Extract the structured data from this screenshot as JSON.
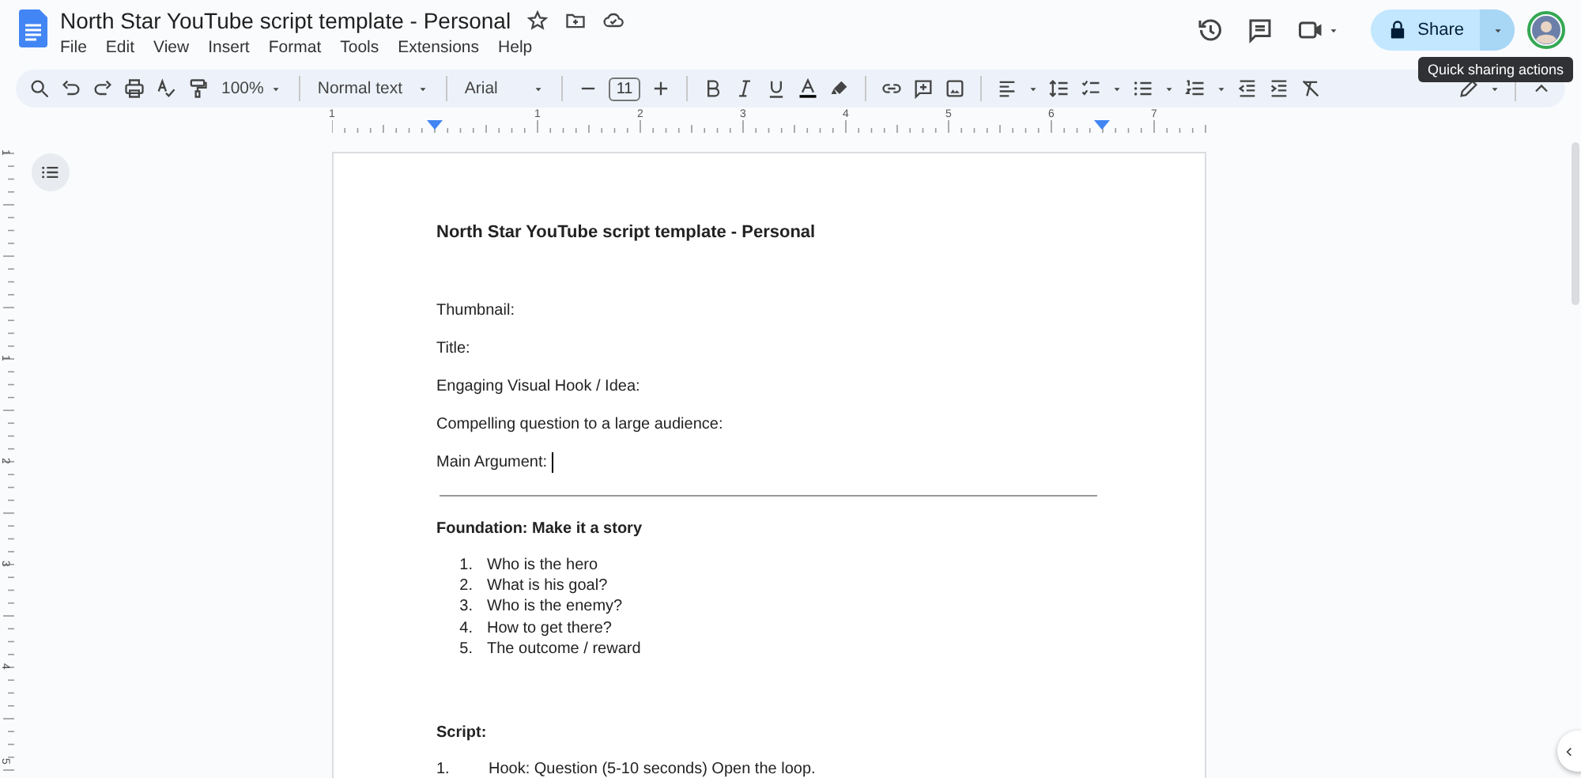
{
  "window": {
    "title": "North Star YouTube script template - Personal"
  },
  "menu": [
    "File",
    "Edit",
    "View",
    "Insert",
    "Format",
    "Tools",
    "Extensions",
    "Help"
  ],
  "share": {
    "label": "Share"
  },
  "tooltip": "Quick sharing actions",
  "toolbar": {
    "zoom": "100%",
    "style": "Normal text",
    "font": "Arial",
    "font_size": "11"
  },
  "ruler": {
    "horizontal": [
      "1",
      "1",
      "2",
      "3",
      "4",
      "5",
      "6",
      "7"
    ],
    "vertical": [
      "1",
      "1",
      "2",
      "3",
      "4",
      "5"
    ]
  },
  "document": {
    "title": "North Star YouTube script template - Personal",
    "fields": [
      {
        "text": "Thumbnail:",
        "cursor": false
      },
      {
        "text": "Title:",
        "cursor": false
      },
      {
        "text": "Engaging Visual Hook / Idea:",
        "cursor": false
      },
      {
        "text": "Compelling question to a large audience:",
        "cursor": false
      },
      {
        "text": "Main Argument:",
        "cursor": true
      }
    ],
    "section_heading": "Foundation: Make it a story",
    "list": [
      {
        "number": "1.",
        "text": "Who is the hero"
      },
      {
        "number": "2.",
        "text": "What is his goal?"
      },
      {
        "number": "3.",
        "text": "Who is the enemy?"
      },
      {
        "number": "4.",
        "text": "How to get there?"
      },
      {
        "number": "5.",
        "text": "The outcome / reward"
      }
    ],
    "script_heading": "Script:",
    "script_items": [
      {
        "number": "1.",
        "text": "Hook: Question (5-10 seconds) Open the loop."
      }
    ]
  }
}
